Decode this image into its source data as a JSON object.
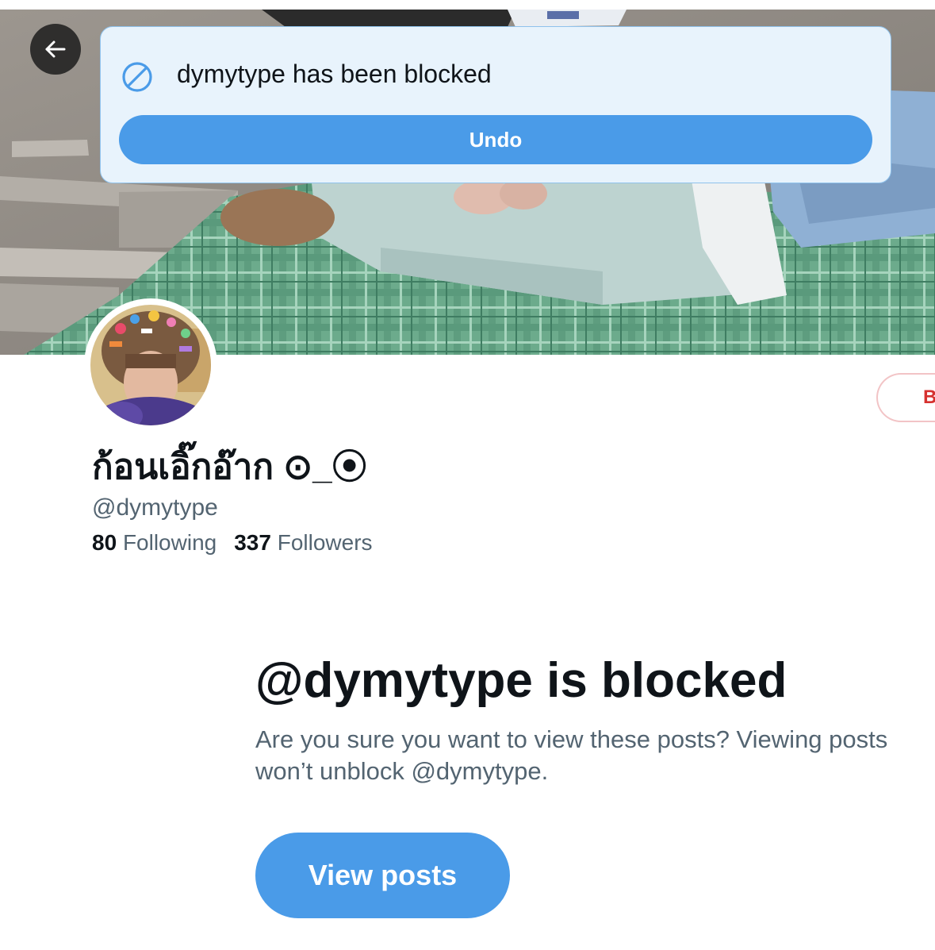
{
  "icons": {
    "back": "arrow-left-icon",
    "toast": "block-icon"
  },
  "toast": {
    "message": "dymytype has been blocked",
    "undo_label": "Undo"
  },
  "profile": {
    "display_name": "ก้อนเอิ๊กอ๊าก ⊙_⦿",
    "handle": "@dymytype",
    "following_count": "80",
    "following_label": "Following",
    "followers_count": "337",
    "followers_label": "Followers",
    "blocked_button_label": "B"
  },
  "blocked_notice": {
    "title": "@dymytype is blocked",
    "description": "Are you sure you want to view these posts? Viewing posts won’t unblock @dymytype.",
    "view_posts_label": "View posts"
  },
  "colors": {
    "accent": "#4a9be8",
    "toast_background": "#e8f3fc",
    "text_primary": "#0f1419",
    "text_secondary": "#536471",
    "danger": "#d6312f"
  }
}
